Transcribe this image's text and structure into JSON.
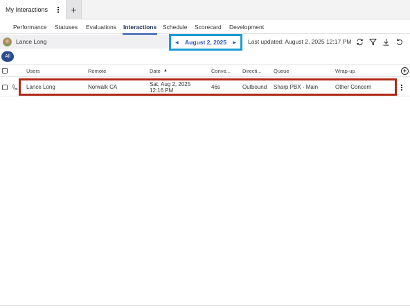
{
  "app_tab": {
    "title": "My Interactions"
  },
  "icons": {
    "kebab": "⋮",
    "plus": "+",
    "prev": "◀",
    "next": "▶",
    "sort_asc": "▲",
    "add_column": "+"
  },
  "subnav": {
    "tabs": [
      "Performance",
      "Statuses",
      "Evaluations",
      "Interactions",
      "Schedule",
      "Scorecard",
      "Development"
    ],
    "active": "Interactions"
  },
  "header": {
    "agent_name": "Lance Long",
    "date": "August 2, 2025",
    "last_updated": "Last updated: August 2, 2025 12:17 PM",
    "toolbar_icons": [
      "refresh-icon",
      "filter-icon",
      "download-icon",
      "reset-icon"
    ]
  },
  "filter_pill": "All",
  "table": {
    "columns": [
      "Users",
      "Remote",
      "Date",
      "Conve...",
      "Directi...",
      "Queue",
      "Wrap-up"
    ],
    "rows": [
      {
        "user": "Lance Long",
        "remote": "Norwalk CA",
        "date_line1": "Sat, Aug 2, 2025",
        "date_line2": "12:16 PM",
        "conversation": "46s",
        "direction": "Outbound",
        "queue": "Sharp PBX - Main",
        "wrapup": "Other Concern"
      }
    ]
  },
  "colors": {
    "accent": "#2e56b3",
    "date_nav_highlight": "#1c9bd5",
    "row_highlight": "#b02a16",
    "pill": "#2a4a8c"
  }
}
